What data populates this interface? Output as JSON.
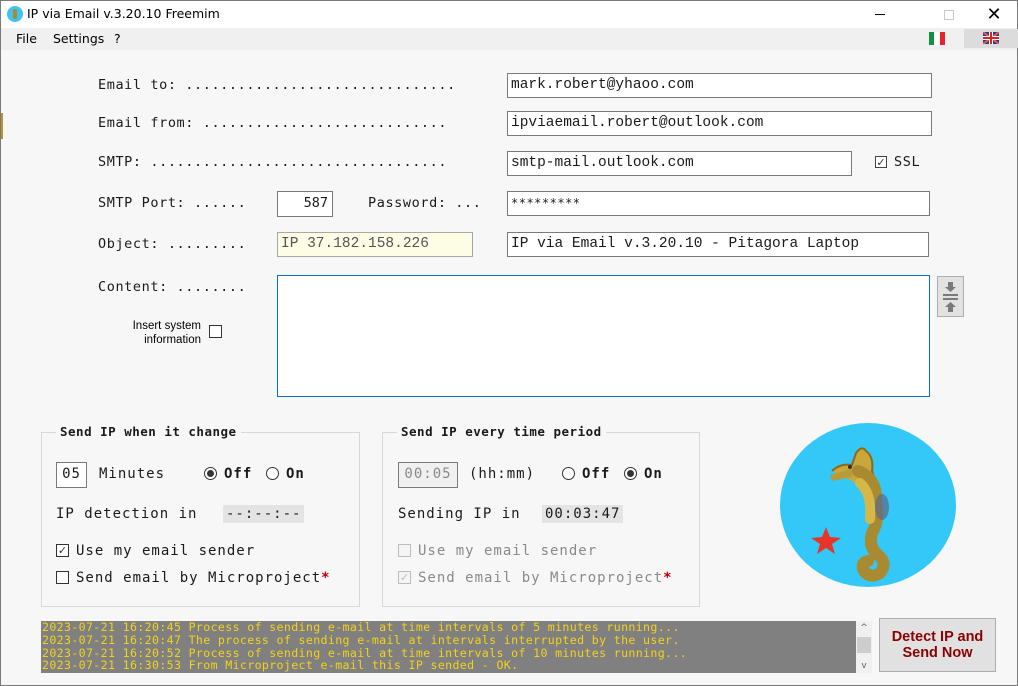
{
  "window": {
    "title": "IP via Email v.3.20.10 Freemim",
    "controls": {
      "minimize": "—",
      "maximize": "☐",
      "close": "✕"
    }
  },
  "menu": {
    "items": [
      "File",
      "Settings",
      "?"
    ],
    "languages": [
      "Italian",
      "English"
    ]
  },
  "form": {
    "email_to": {
      "label": "Email to: ...............................",
      "value": "mark.robert@yhaoo.com"
    },
    "email_from": {
      "label": "Email from: ............................",
      "value": "ipviaemail.robert@outlook.com"
    },
    "smtp": {
      "label": "SMTP: ..................................",
      "value": "smtp-mail.outlook.com",
      "ssl_label": "SSL",
      "ssl_checked": true
    },
    "smtp_port": {
      "label": "SMTP Port: ......",
      "value": "587"
    },
    "password": {
      "label": "Password: ...",
      "value": "*********"
    },
    "object": {
      "label": "Object: .........",
      "ip_value": "IP 37.182.158.226",
      "subject_value": "IP via Email v.3.20.10 - Pitagora Laptop"
    },
    "content": {
      "label": "Content: ........",
      "value": ""
    },
    "insert_system_info": {
      "label_line1": "Insert system",
      "label_line2": "information",
      "checked": false
    }
  },
  "group_change": {
    "title": "Send IP when it change",
    "minutes_value": "05",
    "minutes_label": "Minutes",
    "off_label": "Off",
    "on_label": "On",
    "selected": "Off",
    "detection_label": "IP detection in",
    "detection_timer": "--:--:--",
    "use_my_sender": {
      "label": "Use my email sender",
      "checked": true,
      "enabled": true
    },
    "send_by_microproject": {
      "label": "Send email by Microproject",
      "checked": false,
      "enabled": true,
      "required_mark": "*"
    }
  },
  "group_period": {
    "title": "Send IP every time period",
    "period_value": "00:05",
    "period_format": "(hh:mm)",
    "off_label": "Off",
    "on_label": "On",
    "selected": "On",
    "sending_label": "Sending IP in",
    "sending_timer": "00:03:47",
    "use_my_sender": {
      "label": "Use my email sender",
      "checked": false,
      "enabled": false
    },
    "send_by_microproject": {
      "label": "Send email by Microproject",
      "checked": true,
      "enabled": false,
      "required_mark": "*"
    }
  },
  "log": {
    "lines": [
      "2023-07-21 16:20:45 Process of sending e-mail at time intervals of 5 minutes running...",
      "2023-07-21 16:20:47 The process of sending e-mail at intervals interrupted by the user.",
      "2023-07-21 16:20:52 Process of sending e-mail at time intervals of 10 minutes running...",
      "2023-07-21 16:30:53 From Microproject e-mail this IP sended - OK."
    ],
    "scroll_up": "^",
    "scroll_down": "v"
  },
  "actions": {
    "detect_send_label": "Detect IP and Send Now"
  },
  "colors": {
    "log_background": "#808080",
    "log_text": "#f2d21a",
    "send_button_text": "#8b0000",
    "logo_background": "#33c8f7",
    "required_star": "#c00000"
  }
}
